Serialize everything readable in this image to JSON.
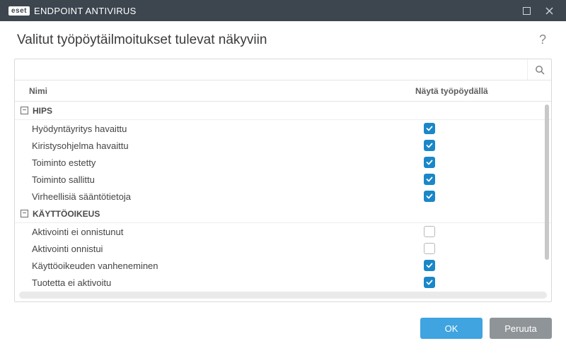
{
  "titlebar": {
    "brand_badge": "eset",
    "product": "ENDPOINT ANTIVIRUS"
  },
  "header": {
    "title": "Valitut työpöytäilmoitukset tulevat näkyviin"
  },
  "search": {
    "value": "",
    "placeholder": ""
  },
  "columns": {
    "name": "Nimi",
    "show": "Näytä työpöydällä"
  },
  "groups": [
    {
      "label": "HIPS",
      "expanded": true,
      "items": [
        {
          "label": "Hyödyntäyritys havaittu",
          "checked": true
        },
        {
          "label": "Kiristysohjelma havaittu",
          "checked": true
        },
        {
          "label": "Toiminto estetty",
          "checked": true
        },
        {
          "label": "Toiminto sallittu",
          "checked": true
        },
        {
          "label": "Virheellisiä sääntötietoja",
          "checked": true
        }
      ]
    },
    {
      "label": "KÄYTTÖOIKEUS",
      "expanded": true,
      "items": [
        {
          "label": "Aktivointi ei onnistunut",
          "checked": false
        },
        {
          "label": "Aktivointi onnistui",
          "checked": false
        },
        {
          "label": "Käyttöoikeuden vanheneminen",
          "checked": true
        },
        {
          "label": "Tuotetta ei aktivoitu",
          "checked": true
        }
      ]
    }
  ],
  "footer": {
    "ok": "OK",
    "cancel": "Peruuta"
  },
  "icons": {
    "collapse_glyph": "−",
    "help_glyph": "?"
  }
}
